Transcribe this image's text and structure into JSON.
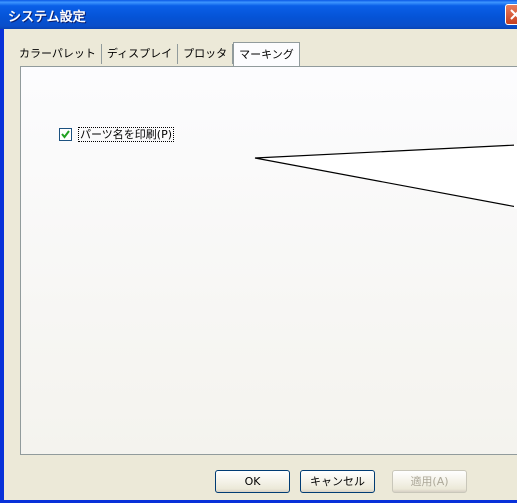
{
  "window": {
    "title": "システム設定"
  },
  "tabs": [
    {
      "label": "カラーパレット"
    },
    {
      "label": "ディスプレイ"
    },
    {
      "label": "プロッタ"
    },
    {
      "label": "マーキング"
    }
  ],
  "active_tab": "マーキング",
  "panel": {
    "checkbox": {
      "label": "パーツ名を印刷(P)",
      "checked": true
    }
  },
  "buttons": {
    "ok": "OK",
    "cancel": "キャンセル",
    "apply": "適用(A)"
  },
  "colors": {
    "titlebar": "#0a58e6",
    "background": "#ece9d8",
    "close": "#c7401f"
  }
}
